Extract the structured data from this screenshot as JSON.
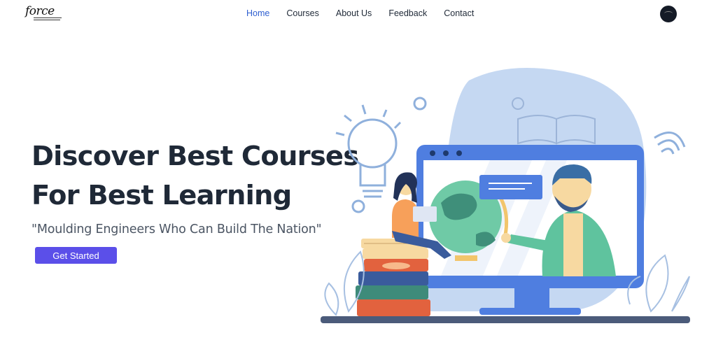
{
  "header": {
    "logo_text": "force",
    "nav": [
      {
        "label": "Home",
        "active": true
      },
      {
        "label": "Courses",
        "active": false
      },
      {
        "label": "About Us",
        "active": false
      },
      {
        "label": "Feedback",
        "active": false
      },
      {
        "label": "Contact",
        "active": false
      }
    ]
  },
  "hero": {
    "headline_line1": "Discover Best Courses",
    "headline_line2": "For Best Learning",
    "tagline": "\"Moulding Engineers Who Can Build The Nation\"",
    "cta_label": "Get Started"
  },
  "colors": {
    "accent": "#5b4fe9",
    "nav_active": "#2e5fd0",
    "text": "#1f2937",
    "blob": "#c5d8f2",
    "monitor": "#4f7ee0"
  },
  "icons": [
    "lightbulb-icon",
    "open-book-icon",
    "wifi-icon",
    "globe-icon",
    "chat-bubble-icon"
  ]
}
